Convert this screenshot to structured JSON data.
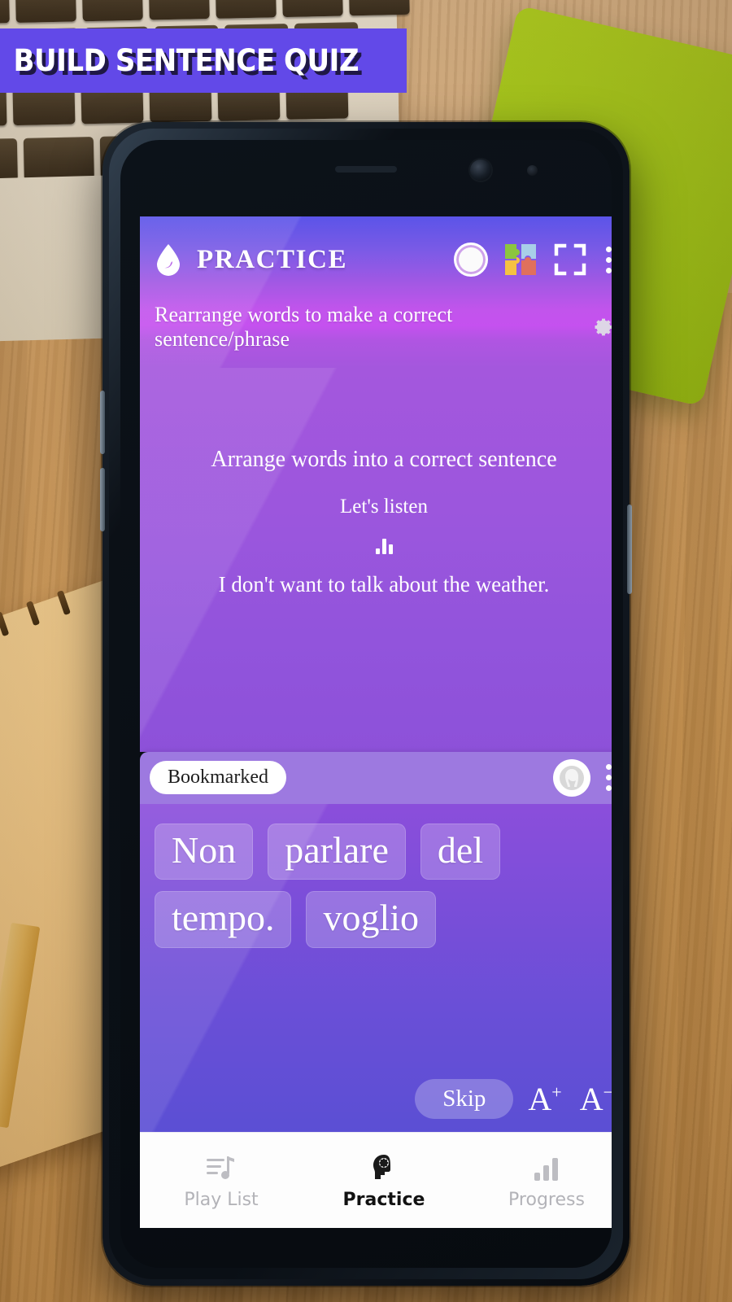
{
  "promo": {
    "banner_text": "BUILD SENTENCE QUIZ",
    "banner_bg": "#6249e8",
    "banner_text_color": "#ffffff"
  },
  "app": {
    "title": "PRACTICE",
    "subtitle": "Rearrange words to make a correct sentence/phrase",
    "logo_icon": "water-drop-icon",
    "accent_gradient_top": "#5b54e8",
    "accent_gradient_mid": "#c551ef",
    "accent_gradient_bottom": "#5b4fd4",
    "actions": [
      {
        "name": "record-circle-icon",
        "label": ""
      },
      {
        "name": "puzzle-icon",
        "label": ""
      },
      {
        "name": "fullscreen-icon",
        "label": ""
      },
      {
        "name": "overflow-menu-icon",
        "label": ""
      }
    ],
    "settings_icon": "gear-icon"
  },
  "question": {
    "instruction": "Arrange words into a correct sentence",
    "listen_prompt": "Let's listen",
    "audio_icon": "equalizer-icon",
    "sentence": "I don't want to talk about the weather."
  },
  "bookmark_bar": {
    "pill_label": "Bookmarked",
    "avatar_icon": "person-avatar-icon",
    "menu_icon": "overflow-menu-icon"
  },
  "word_tiles": [
    {
      "text": "Non"
    },
    {
      "text": "parlare"
    },
    {
      "text": "del"
    },
    {
      "text": "tempo."
    },
    {
      "text": "voglio"
    }
  ],
  "controls": {
    "skip_label": "Skip",
    "font_increase": "A",
    "font_increase_sup": "+",
    "font_decrease": "A",
    "font_decrease_sup": "−"
  },
  "bottom_nav": {
    "items": [
      {
        "label": "Play List",
        "icon": "music-playlist-icon",
        "active": false
      },
      {
        "label": "Practice",
        "icon": "head-gear-icon",
        "active": true
      },
      {
        "label": "Progress",
        "icon": "bar-chart-icon",
        "active": false
      }
    ]
  }
}
